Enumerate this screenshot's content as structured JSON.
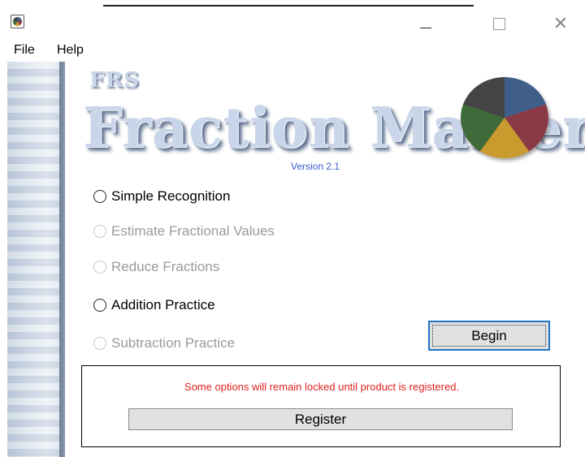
{
  "menu": {
    "file": "File",
    "help": "Help"
  },
  "logo": {
    "brand": "FRS",
    "title": "Fraction Master",
    "version": "Version 2.1",
    "pie_colors": [
      "#3f5f8a",
      "#8a3a45",
      "#c99a2e",
      "#3f6a3a",
      "#444444"
    ]
  },
  "options": [
    {
      "label": "Simple Recognition",
      "enabled": true
    },
    {
      "label": "Estimate Fractional Values",
      "enabled": false
    },
    {
      "label": "Reduce Fractions",
      "enabled": false
    },
    {
      "label": "Addition Practice",
      "enabled": true
    },
    {
      "label": "Subtraction Practice",
      "enabled": false
    }
  ],
  "buttons": {
    "begin": "Begin",
    "register": "Register"
  },
  "registration": {
    "message": "Some options will remain locked until product is registered."
  },
  "colors": {
    "accent_blue": "#1e73c9",
    "warning_red": "#e02020",
    "disabled_text": "#9a9a9a"
  }
}
